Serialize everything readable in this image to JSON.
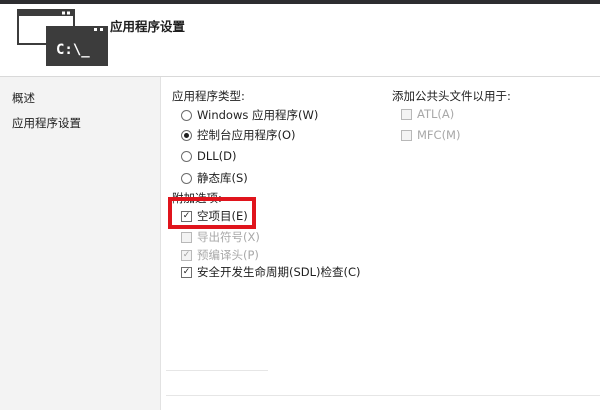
{
  "header": {
    "title": "应用程序设置",
    "icon_text": "C:\\_"
  },
  "sidebar": {
    "items": [
      {
        "label": "概述"
      },
      {
        "label": "应用程序设置"
      }
    ]
  },
  "app_type": {
    "label": "应用程序类型:",
    "options": [
      {
        "label": "Windows 应用程序(W)",
        "selected": false
      },
      {
        "label": "控制台应用程序(O)",
        "selected": true
      },
      {
        "label": "DLL(D)",
        "selected": false
      },
      {
        "label": "静态库(S)",
        "selected": false
      }
    ]
  },
  "extra": {
    "label": "附加选项:",
    "options": [
      {
        "label": "空项目(E)",
        "checked": true,
        "enabled": true
      },
      {
        "label": "导出符号(X)",
        "checked": false,
        "enabled": false
      },
      {
        "label": "预编译头(P)",
        "checked": true,
        "enabled": false
      },
      {
        "label": "安全开发生命周期(SDL)检查(C)",
        "checked": true,
        "enabled": true
      }
    ]
  },
  "headers": {
    "label": "添加公共头文件以用于:",
    "options": [
      {
        "label": "ATL(A)",
        "checked": false,
        "enabled": false
      },
      {
        "label": "MFC(M)",
        "checked": false,
        "enabled": false
      }
    ]
  },
  "colors": {
    "highlight": "#e0141c",
    "header_strip": "#2d2d30"
  }
}
